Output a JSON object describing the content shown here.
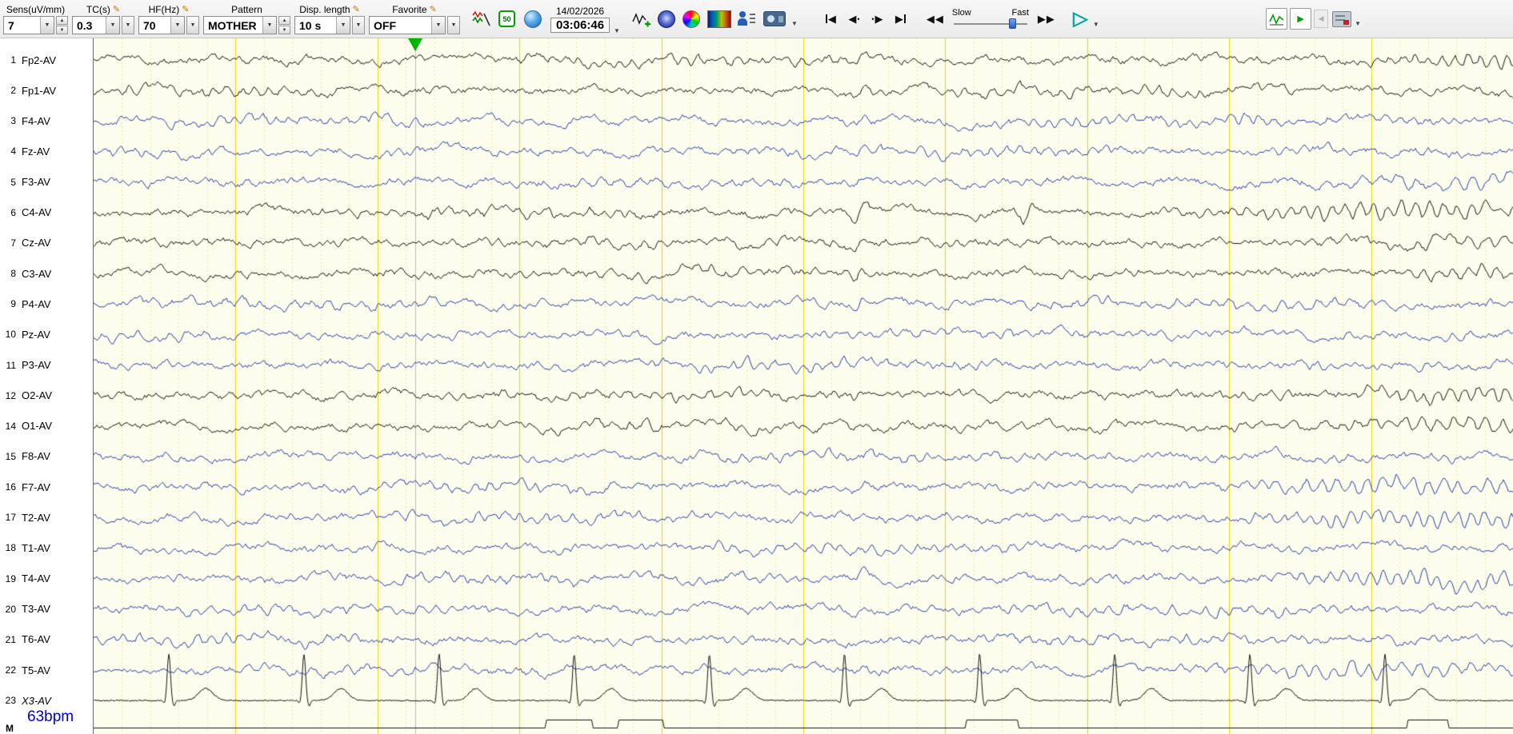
{
  "toolbar": {
    "sens": {
      "label": "Sens(uV/mm)",
      "value": "7"
    },
    "tc": {
      "label": "TC(s)",
      "value": "0.3"
    },
    "hf": {
      "label": "HF(Hz)",
      "value": "70"
    },
    "pattern": {
      "label": "Pattern",
      "value": "MOTHER"
    },
    "disp_length": {
      "label": "Disp. length",
      "value": "10 s"
    },
    "favorite": {
      "label": "Favorite",
      "value": "OFF"
    },
    "hz50": "50",
    "date": "14/02/2026",
    "time": "03:06:46",
    "speed_slow": "Slow",
    "speed_fast": "Fast"
  },
  "icons": {
    "up": "▲",
    "down": "▼",
    "left": "◀",
    "right": "▶",
    "play": "▷",
    "pencil": "✎",
    "dot": "•"
  },
  "channels": [
    {
      "num": "1",
      "label": "Fp2-AV",
      "color": "black"
    },
    {
      "num": "2",
      "label": "Fp1-AV",
      "color": "black"
    },
    {
      "num": "3",
      "label": "F4-AV",
      "color": "blue"
    },
    {
      "num": "4",
      "label": "Fz-AV",
      "color": "blue"
    },
    {
      "num": "5",
      "label": "F3-AV",
      "color": "blue"
    },
    {
      "num": "6",
      "label": "C4-AV",
      "color": "black"
    },
    {
      "num": "7",
      "label": "Cz-AV",
      "color": "black"
    },
    {
      "num": "8",
      "label": "C3-AV",
      "color": "black"
    },
    {
      "num": "9",
      "label": "P4-AV",
      "color": "blue"
    },
    {
      "num": "10",
      "label": "Pz-AV",
      "color": "blue"
    },
    {
      "num": "11",
      "label": "P3-AV",
      "color": "blue"
    },
    {
      "num": "12",
      "label": "O2-AV",
      "color": "black"
    },
    {
      "num": "14",
      "label": "O1-AV",
      "color": "black"
    },
    {
      "num": "15",
      "label": "F8-AV",
      "color": "blue"
    },
    {
      "num": "16",
      "label": "F7-AV",
      "color": "blue"
    },
    {
      "num": "17",
      "label": "T2-AV",
      "color": "blue"
    },
    {
      "num": "18",
      "label": "T1-AV",
      "color": "blue"
    },
    {
      "num": "19",
      "label": "T4-AV",
      "color": "blue"
    },
    {
      "num": "20",
      "label": "T3-AV",
      "color": "blue"
    },
    {
      "num": "21",
      "label": "T6-AV",
      "color": "blue"
    },
    {
      "num": "22",
      "label": "T5-AV",
      "color": "blue"
    },
    {
      "num": "23",
      "label": "X3-AV",
      "color": "black",
      "italic": true,
      "type": "ecg"
    }
  ],
  "hr": "63bpm",
  "marker_label": "M",
  "colors": {
    "bg": "#fdfdee",
    "grid_major": "#e8d400",
    "grid_minor": "#e6dc8e",
    "trace_black": "#161616",
    "trace_blue": "#2b40a6",
    "cursor": "#bcbcbc",
    "marker_green": "#00b400",
    "hr_text": "#0000cd"
  },
  "timebase": {
    "seconds": 10,
    "cursor_fraction": 0.2265
  },
  "ecg": {
    "bpm": 63,
    "first_beat": 0.53,
    "interval": 0.952
  },
  "marker_pulses": [
    [
      0.318,
      0.352
    ],
    [
      0.369,
      0.402
    ],
    [
      0.614,
      0.652
    ],
    [
      0.925,
      0.955
    ]
  ]
}
